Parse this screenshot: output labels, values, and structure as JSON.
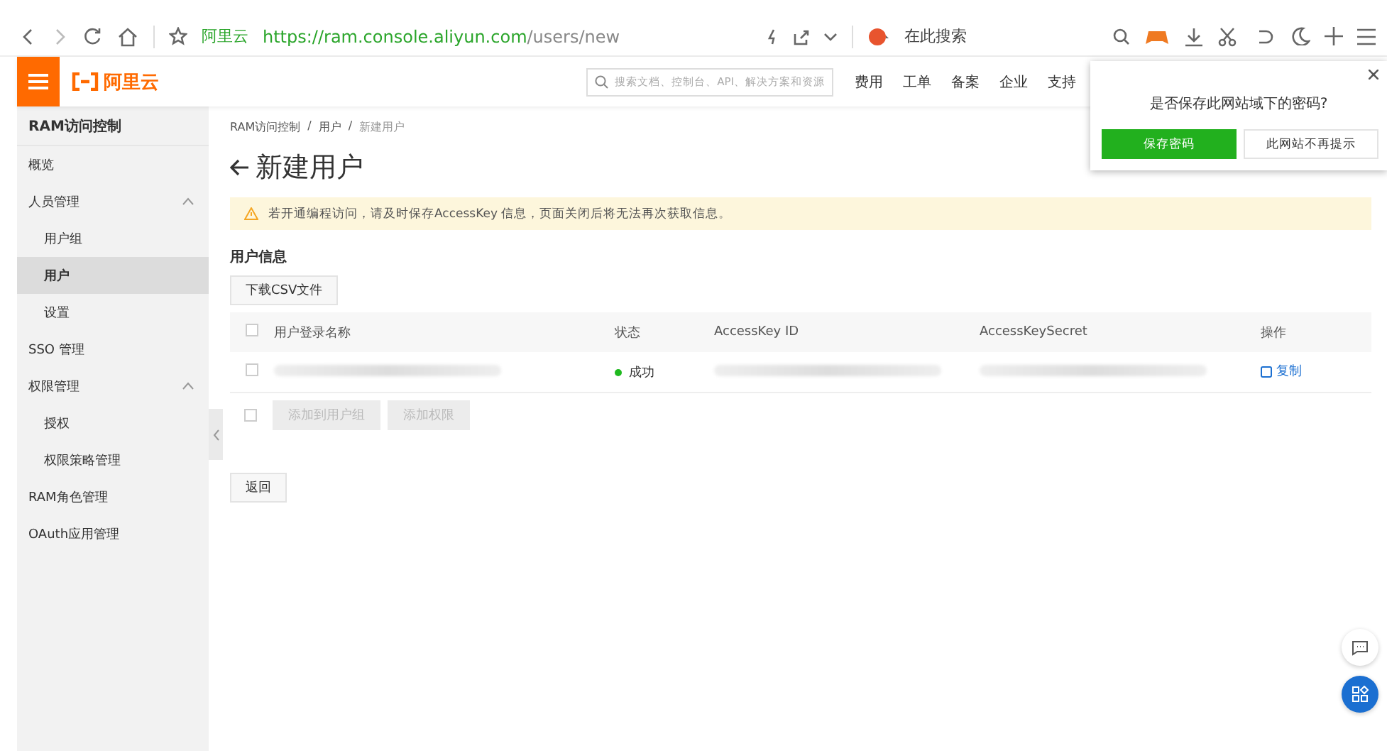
{
  "browser": {
    "site_name": "阿里云",
    "url_host": "https://ram.console.aliyun.com",
    "url_path": "/users/new",
    "search_placeholder": "在此搜索"
  },
  "header": {
    "logo": "阿里云",
    "search_placeholder": "搜索文档、控制台、API、解决方案和资源",
    "nav": [
      "费用",
      "工单",
      "备案",
      "企业",
      "支持"
    ]
  },
  "sidebar": {
    "title": "RAM访问控制",
    "items": [
      {
        "label": "概览",
        "selected": false
      },
      {
        "label": "人员管理",
        "selected": false,
        "expanded": true,
        "children": [
          {
            "label": "用户组",
            "selected": false
          },
          {
            "label": "用户",
            "selected": true
          },
          {
            "label": "设置",
            "selected": false
          }
        ]
      },
      {
        "label": "SSO 管理",
        "selected": false
      },
      {
        "label": "权限管理",
        "selected": false,
        "expanded": true,
        "children": [
          {
            "label": "授权",
            "selected": false
          },
          {
            "label": "权限策略管理",
            "selected": false
          }
        ]
      },
      {
        "label": "RAM角色管理",
        "selected": false
      },
      {
        "label": "OAuth应用管理",
        "selected": false
      }
    ]
  },
  "breadcrumb": {
    "items": [
      "RAM访问控制",
      "用户",
      "新建用户"
    ],
    "separators": [
      "/",
      "/"
    ]
  },
  "page_title": "新建用户",
  "alert": "若开通编程访问，请及时保存AccessKey 信息，页面关闭后将无法再次获取信息。",
  "section_title": "用户信息",
  "download_button": "下载CSV文件",
  "table": {
    "all_checked": false,
    "columns": [
      "用户登录名称",
      "状态",
      "AccessKey ID",
      "AccessKeySecret",
      "操作"
    ],
    "rows": [
      {
        "checked": false,
        "cells": [
          {
            "kind": "redacted"
          },
          {
            "kind": "status",
            "text": "成功",
            "color": "#1fb91f"
          },
          {
            "kind": "redacted"
          },
          {
            "kind": "redacted"
          },
          {
            "kind": "link",
            "text": "复制"
          }
        ]
      }
    ],
    "footer": {
      "checked": false,
      "buttons": [
        {
          "label": "添加到用户组",
          "disabled": true
        },
        {
          "label": "添加权限",
          "disabled": true
        }
      ]
    }
  },
  "back_button": "返回",
  "password_prompt": {
    "question": "是否保存此网站域下的密码?",
    "buttons": [
      {
        "label": "保存密码",
        "primary": true
      },
      {
        "label": "此网站不再提示",
        "primary": false
      }
    ]
  }
}
